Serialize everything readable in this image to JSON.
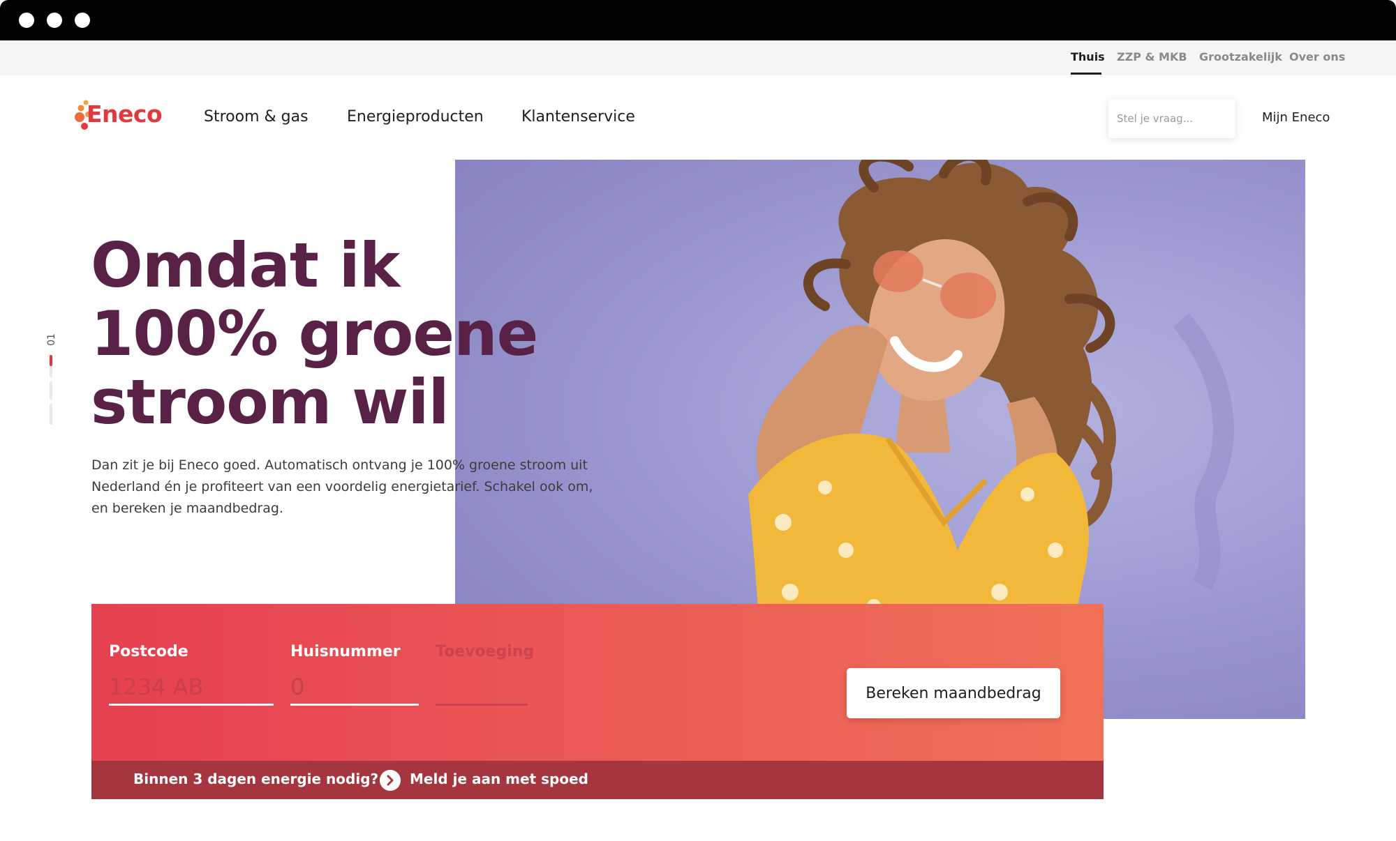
{
  "window": {
    "controls": [
      "close",
      "minimize",
      "maximize"
    ]
  },
  "utility_nav": {
    "items": [
      {
        "label": "Thuis",
        "active": true
      },
      {
        "label": "ZZP & MKB",
        "active": false
      },
      {
        "label": "Grootzakelijk",
        "active": false
      },
      {
        "label": "Over ons",
        "active": false
      }
    ]
  },
  "brand": {
    "name": "Eneco",
    "color": "#e03a3e"
  },
  "main_nav": {
    "items": [
      "Stroom & gas",
      "Energieproducten",
      "Klantenservice"
    ],
    "search_placeholder": "Stel je vraag...",
    "account_label": "Mijn Eneco"
  },
  "hero": {
    "slide_number": "01",
    "headline_lines": [
      "Omdat ik",
      "100% groene",
      "stroom wil"
    ],
    "lead": "Dan zit je bij Eneco goed. Automatisch ontvang je 100% groene stroom uit Nederland én je profiteert van een voordelig energietarief. Schakel ook om, en bereken je maandbedrag.",
    "image_alt": "Lachende vrouw met zonnebril in gele stippenjurk"
  },
  "calculator": {
    "postcode_label": "Postcode",
    "postcode_placeholder": "1234 AB",
    "huisnummer_label": "Huisnummer",
    "huisnummer_placeholder": "0",
    "toevoeging_label": "Toevoeging",
    "toevoeging_placeholder": "",
    "submit_label": "Bereken maandbedrag"
  },
  "urgent": {
    "question": "Binnen 3 dagen energie nodig?",
    "link": "Meld je aan met spoed"
  },
  "colors": {
    "headline": "#5a2146",
    "calc_start": "#e5404f",
    "calc_end": "#f07158",
    "urgent_bar": "#a5363f",
    "hero_bg": "#a3a0d6"
  }
}
